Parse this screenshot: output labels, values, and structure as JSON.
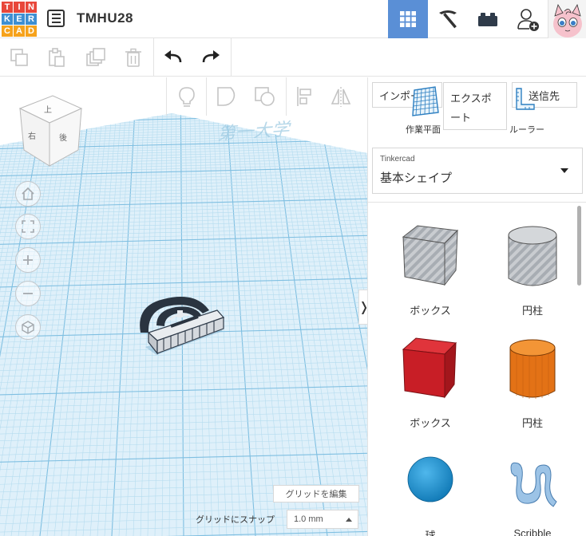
{
  "app": {
    "logo_letters": [
      "T",
      "I",
      "N",
      "K",
      "E",
      "R",
      "C",
      "A",
      "D"
    ],
    "logo_colors": [
      "#e8473a",
      "#e8473a",
      "#e8473a",
      "#3e8fd2",
      "#3e8fd2",
      "#3e8fd2",
      "#f6a21b",
      "#f6a21b",
      "#f6a21b"
    ],
    "project_title": "TMHU28",
    "accent_color": "#5a8fd6"
  },
  "topbar": {
    "view_buttons": [
      {
        "name": "3d-design-view",
        "icon": "grid-icon",
        "active": true
      },
      {
        "name": "bricks-view",
        "icon": "pickaxe-icon",
        "active": false
      },
      {
        "name": "blocks-view",
        "icon": "brick-icon",
        "active": false
      },
      {
        "name": "invite-user",
        "icon": "add-user-icon",
        "active": false
      }
    ]
  },
  "toolbar": {
    "buttons": [
      {
        "name": "copy",
        "icon": "copy-icon"
      },
      {
        "name": "paste",
        "icon": "paste-icon"
      },
      {
        "name": "duplicate",
        "icon": "duplicate-icon"
      },
      {
        "name": "delete",
        "icon": "trash-icon"
      },
      {
        "name": "undo",
        "icon": "undo-icon"
      },
      {
        "name": "redo",
        "icon": "redo-icon"
      }
    ]
  },
  "view_tools": {
    "buttons": [
      {
        "name": "notes",
        "icon": "lightbulb-icon"
      },
      {
        "name": "shape-outline",
        "icon": "outline-shape-icon"
      },
      {
        "name": "hole",
        "icon": "hole-icon"
      },
      {
        "name": "align",
        "icon": "align-icon"
      },
      {
        "name": "mirror",
        "icon": "mirror-icon"
      }
    ]
  },
  "navcube": {
    "top": "上",
    "front": "後",
    "side": "右"
  },
  "workspace": {
    "edit_grid_label": "グリッドを編集",
    "snap_label": "グリッドにスナップ",
    "snap_value": "1.0 mm",
    "ghost_text": "第一大学"
  },
  "panel": {
    "import_label": "インポート",
    "export_label": "エクスポート",
    "send_label": "送信先",
    "workplane_label": "作業平面",
    "ruler_label": "ルーラー",
    "library_small": "Tinkercad",
    "library_value": "基本シェイプ",
    "shapes": [
      {
        "label": "ボックス",
        "kind": "box-hole",
        "color": "#b9bcc0"
      },
      {
        "label": "円柱",
        "kind": "cylinder-hole",
        "color": "#b9bcc0"
      },
      {
        "label": "ボックス",
        "kind": "box",
        "color": "#d0262d"
      },
      {
        "label": "円柱",
        "kind": "cylinder",
        "color": "#ea7a1a"
      },
      {
        "label": "球",
        "kind": "sphere",
        "color": "#1e93d1"
      },
      {
        "label": "Scribble",
        "kind": "scribble",
        "color": "#8fb8df"
      }
    ]
  }
}
